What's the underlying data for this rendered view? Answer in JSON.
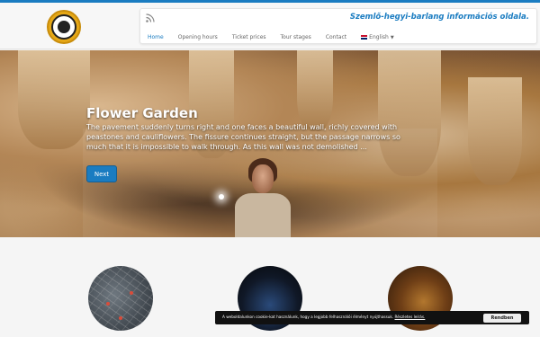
{
  "header": {
    "tagline": "Szemlő-hegyi-barlang információs oldala.",
    "rss_icon": "rss-icon",
    "logo_icon": "cave-logo-icon"
  },
  "nav": {
    "items": [
      {
        "label": "Home",
        "active": true
      },
      {
        "label": "Opening hours",
        "active": false
      },
      {
        "label": "Ticket prices",
        "active": false
      },
      {
        "label": "Tour stages",
        "active": false
      },
      {
        "label": "Contact",
        "active": false
      }
    ],
    "language": {
      "label": "English",
      "icon": "uk-flag-icon"
    }
  },
  "slide": {
    "title": "Flower Garden",
    "text": "The pavement suddenly turns right and one faces a beautiful wall, richly covered with peastones and cauliflowers. The fissure continues straight, but the passage narrows so much that it is impossible to walk through. As this wall was not demolished ...",
    "next_label": "Next"
  },
  "features": [
    {
      "name": "map-thumbnail"
    },
    {
      "name": "night-group-thumbnail"
    },
    {
      "name": "cave-visitors-thumbnail"
    }
  ],
  "cookie": {
    "text": "A weboldalunkon cookie-kat használunk, hogy a legjobb felhasználói élményt nyújthassuk. ",
    "link": "Részletes leírás.",
    "button": "Rendben"
  },
  "colors": {
    "accent": "#1a7cc1",
    "cookie_bar": "#111111"
  }
}
